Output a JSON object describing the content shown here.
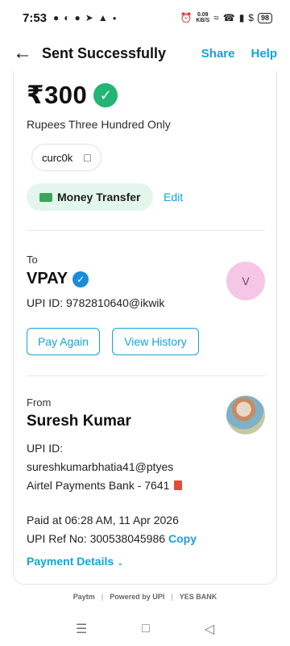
{
  "status_bar": {
    "time": "7:53",
    "net_speed_value": "0.09",
    "net_speed_unit": "KB/S",
    "battery": "98",
    "left_icons": [
      "snapchat-icon",
      "whatsapp-icon",
      "chat-icon",
      "telegram-icon",
      "app-a-icon",
      "dot-icon"
    ],
    "right_icons": [
      "alarm-icon",
      "wifi-icon",
      "call-icon",
      "signal-icon",
      "dollar-icon"
    ]
  },
  "header": {
    "title": "Sent Successfully",
    "share_label": "Share",
    "help_label": "Help"
  },
  "payment": {
    "amount": "₹300",
    "amount_words": "Rupees Three Hundred Only",
    "note": "curc0k",
    "category": "Money Transfer",
    "edit_label": "Edit"
  },
  "recipient": {
    "label": "To",
    "name": "VPAY",
    "upi": "UPI ID: 9782810640@ikwik",
    "avatar_initial": "V",
    "pay_again_label": "Pay Again",
    "view_history_label": "View History"
  },
  "sender": {
    "label": "From",
    "name": "Suresh Kumar",
    "upi_label": "UPI ID:",
    "upi": "sureshkumarbhatia41@ptyes",
    "bank": "Airtel Payments Bank - 7641",
    "paid_at": "Paid at 06:28 AM, 11 Apr 2026",
    "ref_no": "UPI Ref No: 300538045986",
    "copy_label": "Copy",
    "payment_details_label": "Payment Details"
  },
  "footer": {
    "brand_1": "Paytm",
    "brand_2": "Powered by UPI",
    "brand_3": "YES BANK"
  },
  "colors": {
    "accent": "#14a3d9",
    "verified_green": "#22b573",
    "verified_blue": "#1a8cd8",
    "category_bg": "#e3f6ee",
    "avatar_bg": "#f5c6e6"
  }
}
